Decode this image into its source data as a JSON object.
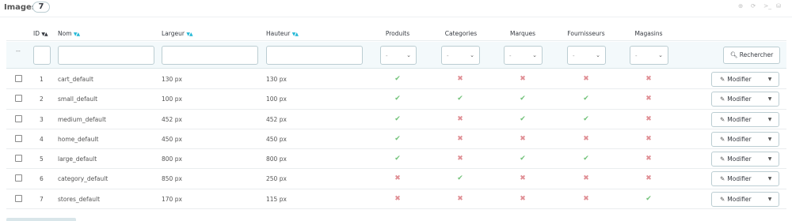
{
  "panel": {
    "title": "Images",
    "count": "7"
  },
  "toolbar": [
    {
      "name": "add-icon",
      "glyph": "⊕"
    },
    {
      "name": "refresh-icon",
      "glyph": "⟳"
    },
    {
      "name": "sql-query-icon",
      "glyph": ">_"
    },
    {
      "name": "database-icon",
      "glyph": "⛁"
    }
  ],
  "columns": {
    "id": "ID",
    "nom": "Nom",
    "largeur": "Largeur",
    "hauteur": "Hauteur",
    "produits": "Produits",
    "categories": "Categories",
    "marques": "Marques",
    "fournisseurs": "Fournisseurs",
    "magasins": "Magasins"
  },
  "filters": {
    "dash": "--",
    "select_value": "-",
    "search_label": "Rechercher"
  },
  "rows": [
    {
      "id": "1",
      "nom": "cart_default",
      "largeur": "130 px",
      "hauteur": "130 px",
      "produits": true,
      "categories": false,
      "marques": false,
      "fournisseurs": false,
      "magasins": false
    },
    {
      "id": "2",
      "nom": "small_default",
      "largeur": "100 px",
      "hauteur": "100 px",
      "produits": true,
      "categories": true,
      "marques": true,
      "fournisseurs": true,
      "magasins": false
    },
    {
      "id": "3",
      "nom": "medium_default",
      "largeur": "452 px",
      "hauteur": "452 px",
      "produits": true,
      "categories": false,
      "marques": true,
      "fournisseurs": true,
      "magasins": false
    },
    {
      "id": "4",
      "nom": "home_default",
      "largeur": "450 px",
      "hauteur": "450 px",
      "produits": true,
      "categories": false,
      "marques": false,
      "fournisseurs": false,
      "magasins": false
    },
    {
      "id": "5",
      "nom": "large_default",
      "largeur": "800 px",
      "hauteur": "800 px",
      "produits": true,
      "categories": false,
      "marques": true,
      "fournisseurs": true,
      "magasins": false
    },
    {
      "id": "6",
      "nom": "category_default",
      "largeur": "850 px",
      "hauteur": "250 px",
      "produits": false,
      "categories": true,
      "marques": false,
      "fournisseurs": false,
      "magasins": false
    },
    {
      "id": "7",
      "nom": "stores_default",
      "largeur": "170 px",
      "hauteur": "115 px",
      "produits": false,
      "categories": false,
      "marques": false,
      "fournisseurs": false,
      "magasins": true
    }
  ],
  "row_action": {
    "label": "Modifier"
  },
  "colors": {
    "yes": "#72c279",
    "no": "#e08f95",
    "accent": "#25b9d7"
  }
}
